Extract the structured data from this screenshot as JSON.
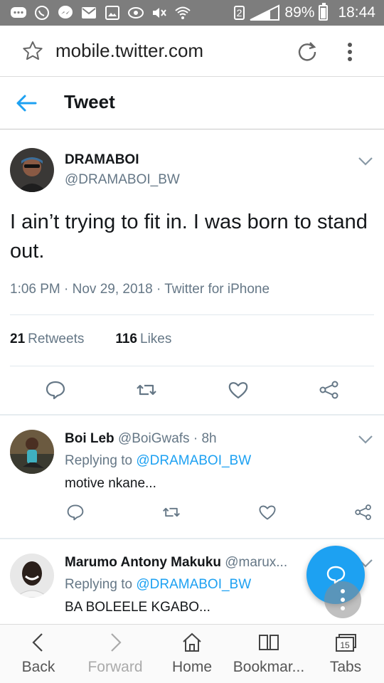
{
  "status_bar": {
    "battery": "89%",
    "time": "18:44",
    "sim": "2",
    "icons": [
      "chat-bubble-icon",
      "whatsapp-icon",
      "messenger-icon",
      "mail-icon",
      "gallery-icon",
      "cloud-icon",
      "mute-icon",
      "wifi-icon",
      "sim-icon",
      "signal-icon",
      "battery-icon"
    ]
  },
  "browser": {
    "url": "mobile.twitter.com"
  },
  "header": {
    "title": "Tweet"
  },
  "tweet": {
    "name": "DRAMABOI",
    "handle": "@DRAMABOI_BW",
    "text": "I ain’t trying to fit in. I was born to stand out.",
    "meta": "1:06 PM · Nov 29, 2018 · Twitter for iPhone",
    "retweets_count": "21",
    "retweets_label": "Retweets",
    "likes_count": "116",
    "likes_label": "Likes"
  },
  "replies": [
    {
      "name": "Boi Leb",
      "handle": "@BoiGwafs",
      "time": "· 8h",
      "replying_prefix": "Replying to",
      "replying_to": "@DRAMABOI_BW",
      "text": "motive nkane..."
    },
    {
      "name": "Marumo Antony Makuku",
      "handle": "@marux...",
      "replying_prefix": "Replying to",
      "replying_to": "@DRAMABOI_BW",
      "text": "BA BOLEELE KGABO..."
    }
  ],
  "bottom_bar": {
    "back": "Back",
    "forward": "Forward",
    "home": "Home",
    "bookmarks": "Bookmar...",
    "tabs": "Tabs",
    "tabs_count": "15"
  },
  "colors": {
    "accent": "#1da1f2",
    "status_bar": "#7d7d7d",
    "secondary_text": "#657786"
  }
}
